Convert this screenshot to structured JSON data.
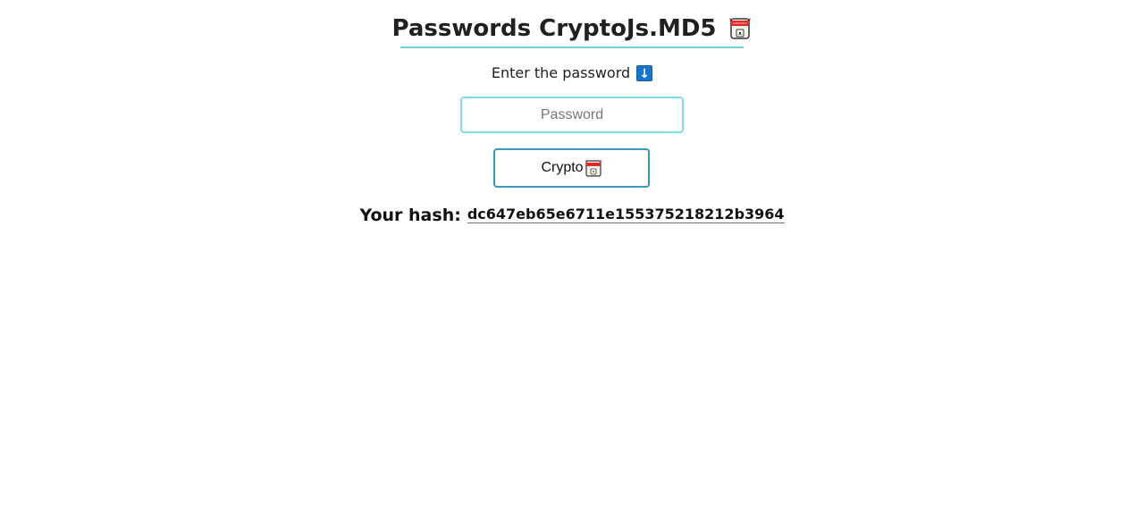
{
  "page": {
    "title": "Passwords CryptoJs.MD5",
    "title_icon": "ninja-icon",
    "subtitle": "Enter the password",
    "subtitle_icon": "down-arrow-icon"
  },
  "form": {
    "password_placeholder": "Password",
    "password_value": "",
    "button_label": "Crypto",
    "button_icon": "ninja-icon"
  },
  "result": {
    "label": "Your hash:",
    "hash": "dc647eb65e6711e155375218212b3964"
  },
  "colors": {
    "accent": "#72cfe0",
    "button_border": "#3a98b9",
    "arrow_blue": "#1976c9"
  }
}
